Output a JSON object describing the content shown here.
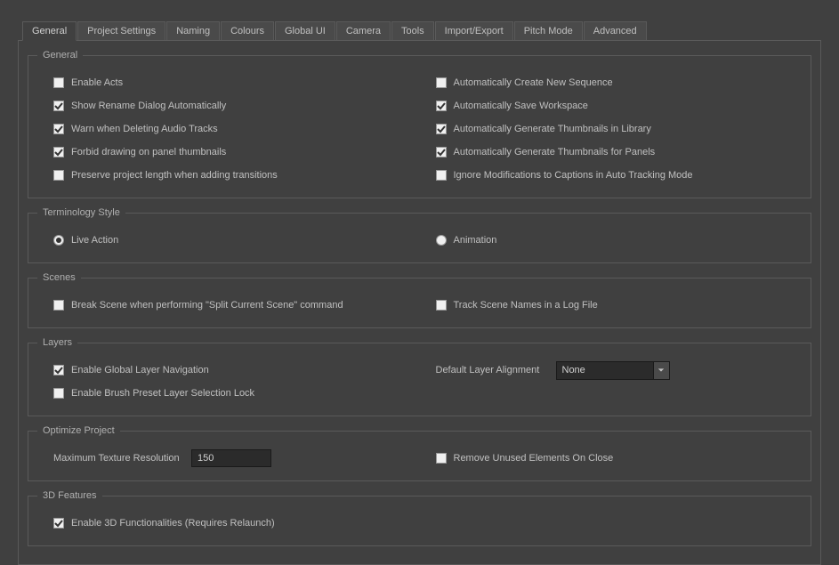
{
  "tabs": [
    {
      "label": "General",
      "active": true
    },
    {
      "label": "Project Settings"
    },
    {
      "label": "Naming"
    },
    {
      "label": "Colours"
    },
    {
      "label": "Global UI"
    },
    {
      "label": "Camera"
    },
    {
      "label": "Tools"
    },
    {
      "label": "Import/Export"
    },
    {
      "label": "Pitch Mode"
    },
    {
      "label": "Advanced"
    }
  ],
  "sections": {
    "general": {
      "title": "General",
      "left": [
        {
          "label": "Enable Acts",
          "checked": false
        },
        {
          "label": "Show Rename Dialog Automatically",
          "checked": true
        },
        {
          "label": "Warn when Deleting Audio Tracks",
          "checked": true
        },
        {
          "label": "Forbid drawing on panel thumbnails",
          "checked": true
        },
        {
          "label": "Preserve project length when adding transitions",
          "checked": false
        }
      ],
      "right": [
        {
          "label": "Automatically Create New Sequence",
          "checked": false
        },
        {
          "label": "Automatically Save Workspace",
          "checked": true
        },
        {
          "label": "Automatically Generate Thumbnails in Library",
          "checked": true
        },
        {
          "label": "Automatically Generate Thumbnails for Panels",
          "checked": true
        },
        {
          "label": "Ignore Modifications to Captions in Auto Tracking Mode",
          "checked": false
        }
      ]
    },
    "terminology": {
      "title": "Terminology Style",
      "options": [
        {
          "label": "Live Action",
          "checked": true
        },
        {
          "label": "Animation",
          "checked": false
        }
      ]
    },
    "scenes": {
      "title": "Scenes",
      "left": {
        "label": "Break Scene when performing \"Split Current Scene\" command",
        "checked": false
      },
      "right": {
        "label": "Track Scene Names in a Log File",
        "checked": false
      }
    },
    "layers": {
      "title": "Layers",
      "left": [
        {
          "label": "Enable Global Layer Navigation",
          "checked": true
        },
        {
          "label": "Enable Brush Preset Layer Selection Lock",
          "checked": false
        }
      ],
      "alignment": {
        "label": "Default Layer Alignment",
        "value": "None"
      }
    },
    "optimize": {
      "title": "Optimize Project",
      "resolution": {
        "label": "Maximum Texture Resolution",
        "value": "150"
      },
      "remove": {
        "label": "Remove Unused Elements On Close",
        "checked": false
      }
    },
    "features3d": {
      "title": "3D Features",
      "item": {
        "label": "Enable 3D Functionalities (Requires Relaunch)",
        "checked": true
      }
    }
  }
}
